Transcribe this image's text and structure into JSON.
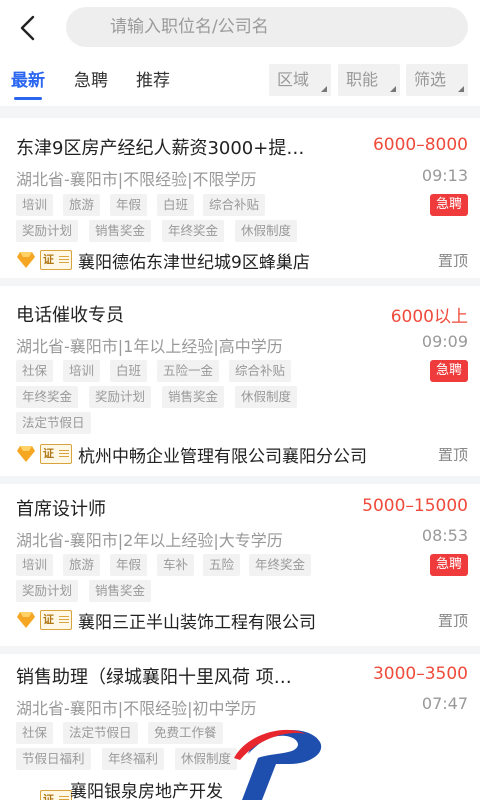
{
  "search": {
    "placeholder": "请输入职位名/公司名"
  },
  "tabs": [
    {
      "label": "最新"
    },
    {
      "label": "急聘"
    },
    {
      "label": "推荐"
    }
  ],
  "filters": [
    {
      "label": "区域"
    },
    {
      "label": "职能"
    },
    {
      "label": "筛选"
    }
  ],
  "cert_label": "证",
  "colors": {
    "accent": "#2a66f0",
    "salary": "#ef4b3c",
    "urgent": "#ef3b3b"
  },
  "jobs": [
    {
      "title": "东津9区房产经纪人薪资3000+提…",
      "salary": "6000–8000",
      "meta": "湖北省-襄阳市|不限经验|不限学历",
      "time": "09:13",
      "tags": [
        "培训",
        "旅游",
        "年假",
        "白班",
        "综合补贴",
        "奖励计划",
        "销售奖金",
        "年终奖金",
        "休假制度"
      ],
      "urgent": "急聘",
      "company": "襄阳德佑东津世纪城9区蜂巢店",
      "pin": "置顶"
    },
    {
      "title": "电话催收专员",
      "salary": "6000以上",
      "meta": "湖北省-襄阳市|1年以上经验|高中学历",
      "time": "09:09",
      "tags": [
        "社保",
        "培训",
        "白班",
        "五险一金",
        "综合补贴",
        "年终奖金",
        "奖励计划",
        "销售奖金",
        "休假制度",
        "法定节假日"
      ],
      "urgent": "急聘",
      "company": "杭州中畅企业管理有限公司襄阳分公司",
      "pin": "置顶"
    },
    {
      "title": "首席设计师",
      "salary": "5000–15000",
      "meta": "湖北省-襄阳市|2年以上经验|大专学历",
      "time": "08:53",
      "tags": [
        "培训",
        "旅游",
        "年假",
        "车补",
        "五险",
        "年终奖金",
        "奖励计划",
        "销售奖金"
      ],
      "urgent": "急聘",
      "company": "襄阳三正半山装饰工程有限公司",
      "pin": "置顶"
    },
    {
      "title": "销售助理（绿城襄阳十里风荷 项…",
      "salary": "3000–3500",
      "meta": "湖北省-襄阳市|不限经验|初中学历",
      "time": "07:47",
      "tags": [
        "社保",
        "法定节假日",
        "免费工作餐",
        "节假日福利",
        "年终福利",
        "休假制度"
      ],
      "company": "襄阳银泉房地产开发"
    }
  ]
}
